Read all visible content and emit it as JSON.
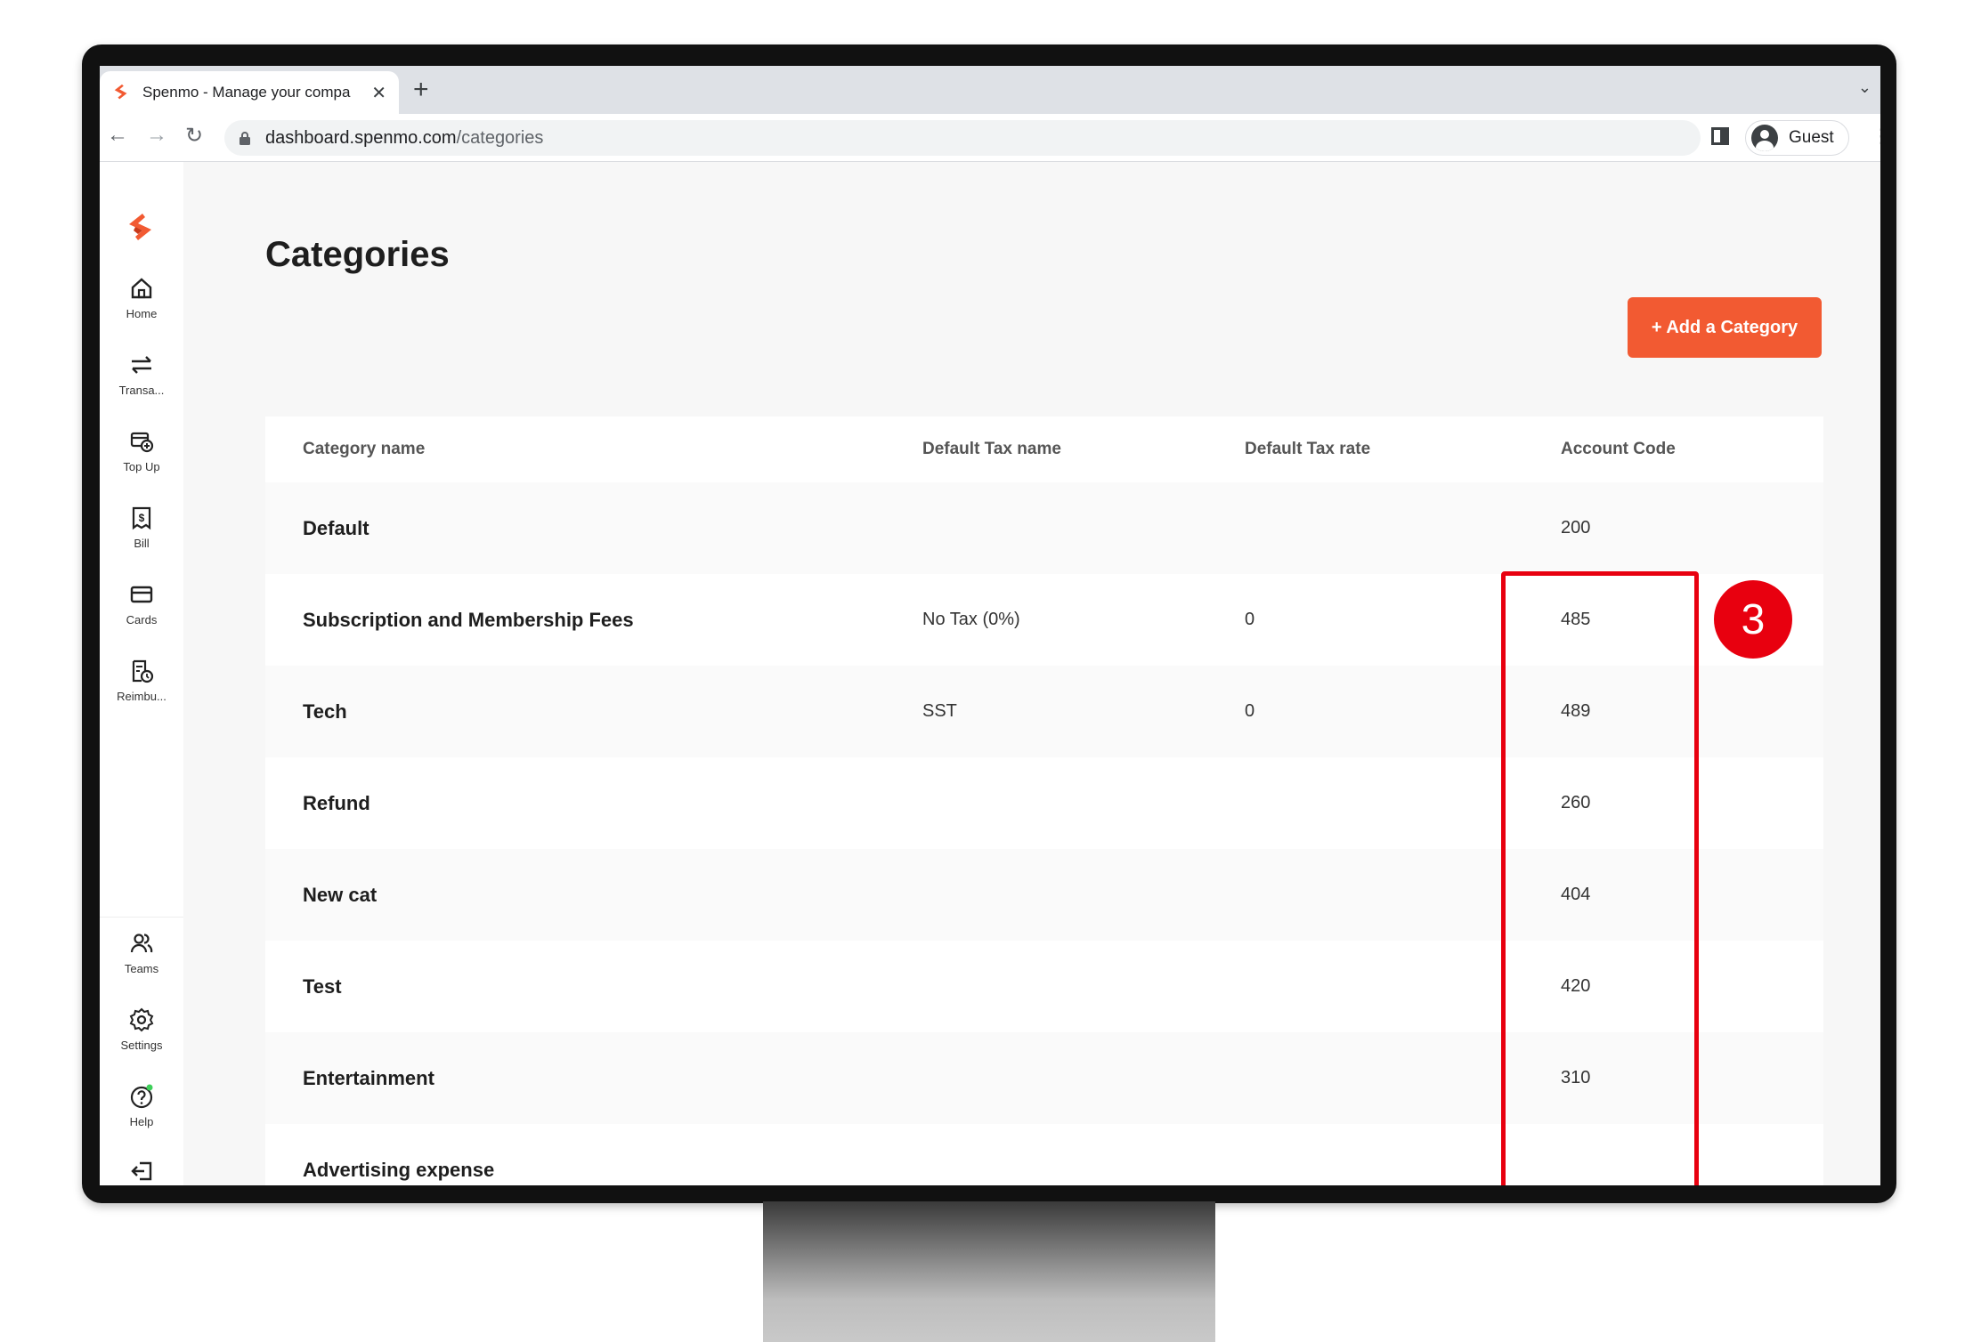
{
  "browser": {
    "tab_title": "Spenmo - Manage your compa",
    "url_host": "dashboard.spenmo.com",
    "url_path": "/categories",
    "profile_name": "Guest",
    "new_tab_glyph": "+",
    "close_glyph": "✕"
  },
  "sidebar": {
    "items": [
      {
        "label": "Home",
        "icon": "home-icon"
      },
      {
        "label": "Transa...",
        "icon": "transactions-icon"
      },
      {
        "label": "Top Up",
        "icon": "topup-icon"
      },
      {
        "label": "Bill",
        "icon": "bill-icon"
      },
      {
        "label": "Cards",
        "icon": "card-icon"
      },
      {
        "label": "Reimbu...",
        "icon": "reimbursement-icon"
      }
    ],
    "bottom_items": [
      {
        "label": "Teams",
        "icon": "teams-icon"
      },
      {
        "label": "Settings",
        "icon": "settings-icon"
      },
      {
        "label": "Help",
        "icon": "help-icon"
      }
    ]
  },
  "page": {
    "title": "Categories",
    "add_button_label": "+ Add a Category"
  },
  "table": {
    "columns": [
      "Category name",
      "Default Tax name",
      "Default Tax rate",
      "Account Code"
    ],
    "rows": [
      {
        "name": "Default",
        "tax_name": "",
        "tax_rate": "",
        "code": "200"
      },
      {
        "name": "Subscription and Membership Fees",
        "tax_name": "No Tax (0%)",
        "tax_rate": "0",
        "code": "485"
      },
      {
        "name": "Tech",
        "tax_name": "SST",
        "tax_rate": "0",
        "code": "489"
      },
      {
        "name": "Refund",
        "tax_name": "",
        "tax_rate": "",
        "code": "260"
      },
      {
        "name": "New cat",
        "tax_name": "",
        "tax_rate": "",
        "code": "404"
      },
      {
        "name": "Test",
        "tax_name": "",
        "tax_rate": "",
        "code": "420"
      },
      {
        "name": "Entertainment",
        "tax_name": "",
        "tax_rate": "",
        "code": "310"
      },
      {
        "name": "Advertising expense",
        "tax_name": "",
        "tax_rate": "",
        "code": ""
      }
    ]
  },
  "annotation": {
    "step_number": "3",
    "color": "#e8000f"
  },
  "colors": {
    "brand": "#f25a32"
  }
}
